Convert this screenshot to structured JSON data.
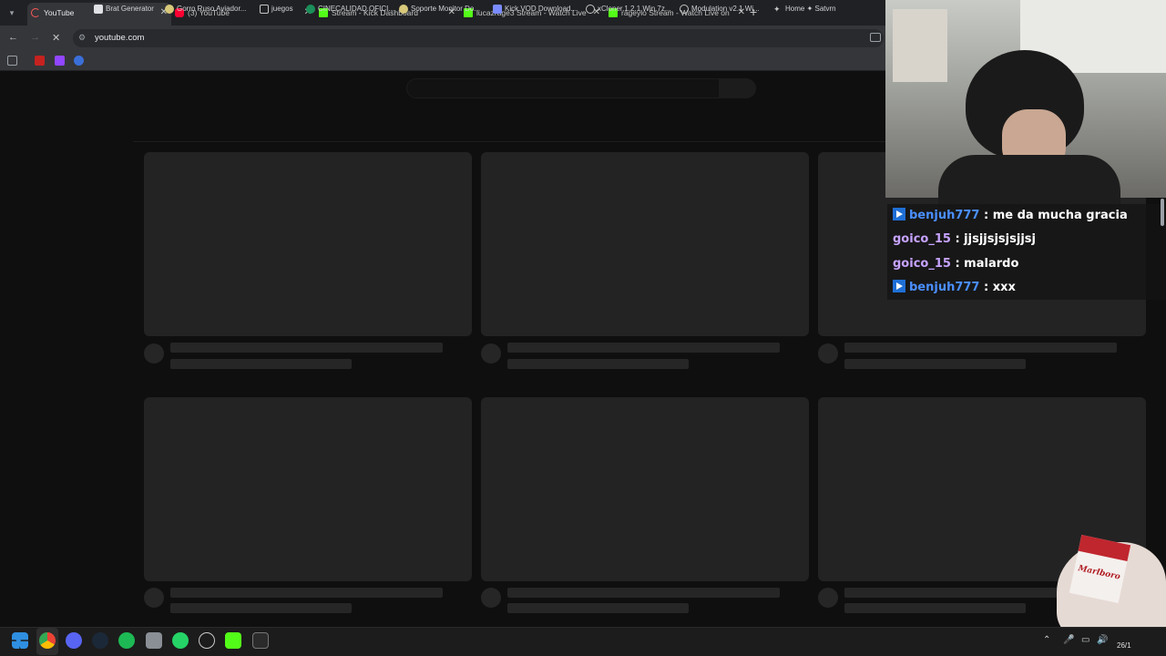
{
  "browser": {
    "tabs": [
      {
        "title": "YouTube",
        "icon": "youtube-loading-icon",
        "active": true
      },
      {
        "title": "(3) YouTube",
        "icon": "youtube-icon",
        "active": false
      },
      {
        "title": "Stream - Kick Dashboard",
        "icon": "kick-icon",
        "active": false
      },
      {
        "title": "lucazrage3 Stream - Watch Live",
        "icon": "kick-icon",
        "active": false
      },
      {
        "title": "rageylo Stream - Watch Live on",
        "icon": "kick-icon",
        "active": false
      }
    ],
    "tab_close_glyph": "✕",
    "new_tab_glyph": "+",
    "address": "youtube.com",
    "bookmarks": [
      "Brat Generator",
      "Gorro Ruso Aviador...",
      "juegos",
      "CINECALIDAD OFICI...",
      "Soporte Monitor Do...",
      "Kick VOD Download...",
      "xCloner.1.2.1 Win.7z...",
      "Modulation v2.1 Wi...",
      "Home ✦ Satvrn"
    ]
  },
  "chat": {
    "messages": [
      {
        "user": "benjuh777",
        "text": ": me da mucha gracia",
        "user_color": "#4a8fff",
        "badge": true
      },
      {
        "user": "goico_15",
        "text": ": jjsjjsjsjsjjsj",
        "user_color": "#c7a3ff",
        "badge": false
      },
      {
        "user": "goico_15",
        "text": ": malardo",
        "user_color": "#c7a3ff",
        "badge": false
      },
      {
        "user": "benjuh777",
        "text": ": xxx",
        "user_color": "#4a8fff",
        "badge": true
      }
    ]
  },
  "pack": {
    "brand": "Marlboro"
  },
  "taskbar": {
    "icons": [
      "windows-start-icon",
      "chrome-icon",
      "discord-icon",
      "steam-icon",
      "spotify-icon",
      "app-icon",
      "whatsapp-icon",
      "app-icon-2",
      "kick-icon",
      "epic-games-icon"
    ],
    "clock": "26/1"
  },
  "colors": {
    "page_bg": "#0f0f0f",
    "skeleton": "#232323",
    "kick_green": "#53fc18",
    "youtube_red": "#ff0033"
  }
}
